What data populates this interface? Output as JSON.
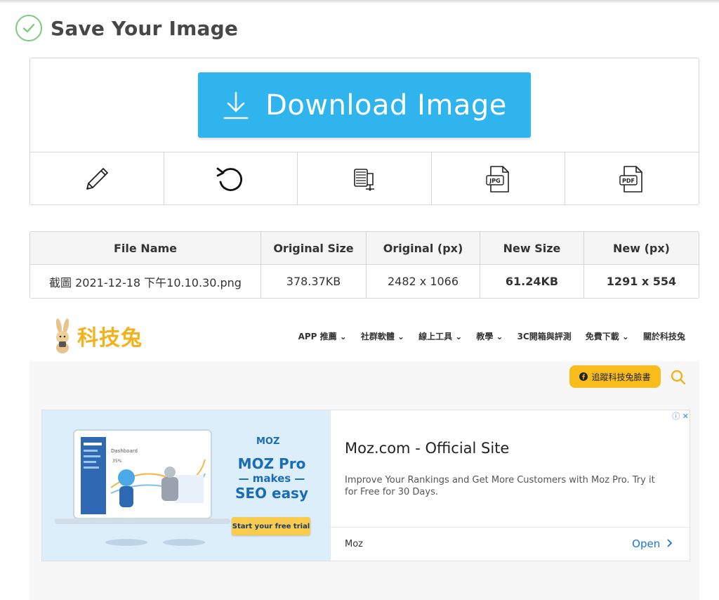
{
  "header": {
    "title": "Save Your Image"
  },
  "download": {
    "label": "Download Image"
  },
  "tools": [
    {
      "icon": "pencil-icon"
    },
    {
      "icon": "rotate-icon"
    },
    {
      "icon": "compress-icon"
    },
    {
      "icon": "jpg-file-icon",
      "label": "JPG"
    },
    {
      "icon": "pdf-file-icon",
      "label": "PDF"
    }
  ],
  "table": {
    "headers": [
      "File Name",
      "Original Size",
      "Original (px)",
      "New Size",
      "New (px)"
    ],
    "row": [
      "截圖 2021-12-18 下午10.10.30.png",
      "378.37KB",
      "2482 x 1066",
      "61.24KB",
      "1291 x 554"
    ]
  },
  "preview": {
    "logo_text": "科技兔",
    "nav": [
      "APP 推薦 ⌄",
      "社群軟體 ⌄",
      "線上工具 ⌄",
      "教學 ⌄",
      "3C開箱與評測",
      "免費下載 ⌄",
      "關於科技兔"
    ],
    "fb_button": "追蹤科技兔臉書",
    "ad": {
      "moz_logo": "MOZ",
      "line1": "MOZ Pro",
      "line2": "— makes —",
      "line3": "SEO easy",
      "trial": "Start your free trial",
      "title": "Moz.com - Official Site",
      "desc": "Improve Your Rankings and Get More Customers with Moz Pro. Try it for Free for 30 Days.",
      "brand": "Moz",
      "open": "Open",
      "adchoice": "ⓘ ✕",
      "dash_title": "Dashboard",
      "dash_pct": "35%"
    }
  },
  "colors": {
    "accent": "#2fb4ee",
    "check": "#7dc97d",
    "brand": "#f2b21b"
  }
}
